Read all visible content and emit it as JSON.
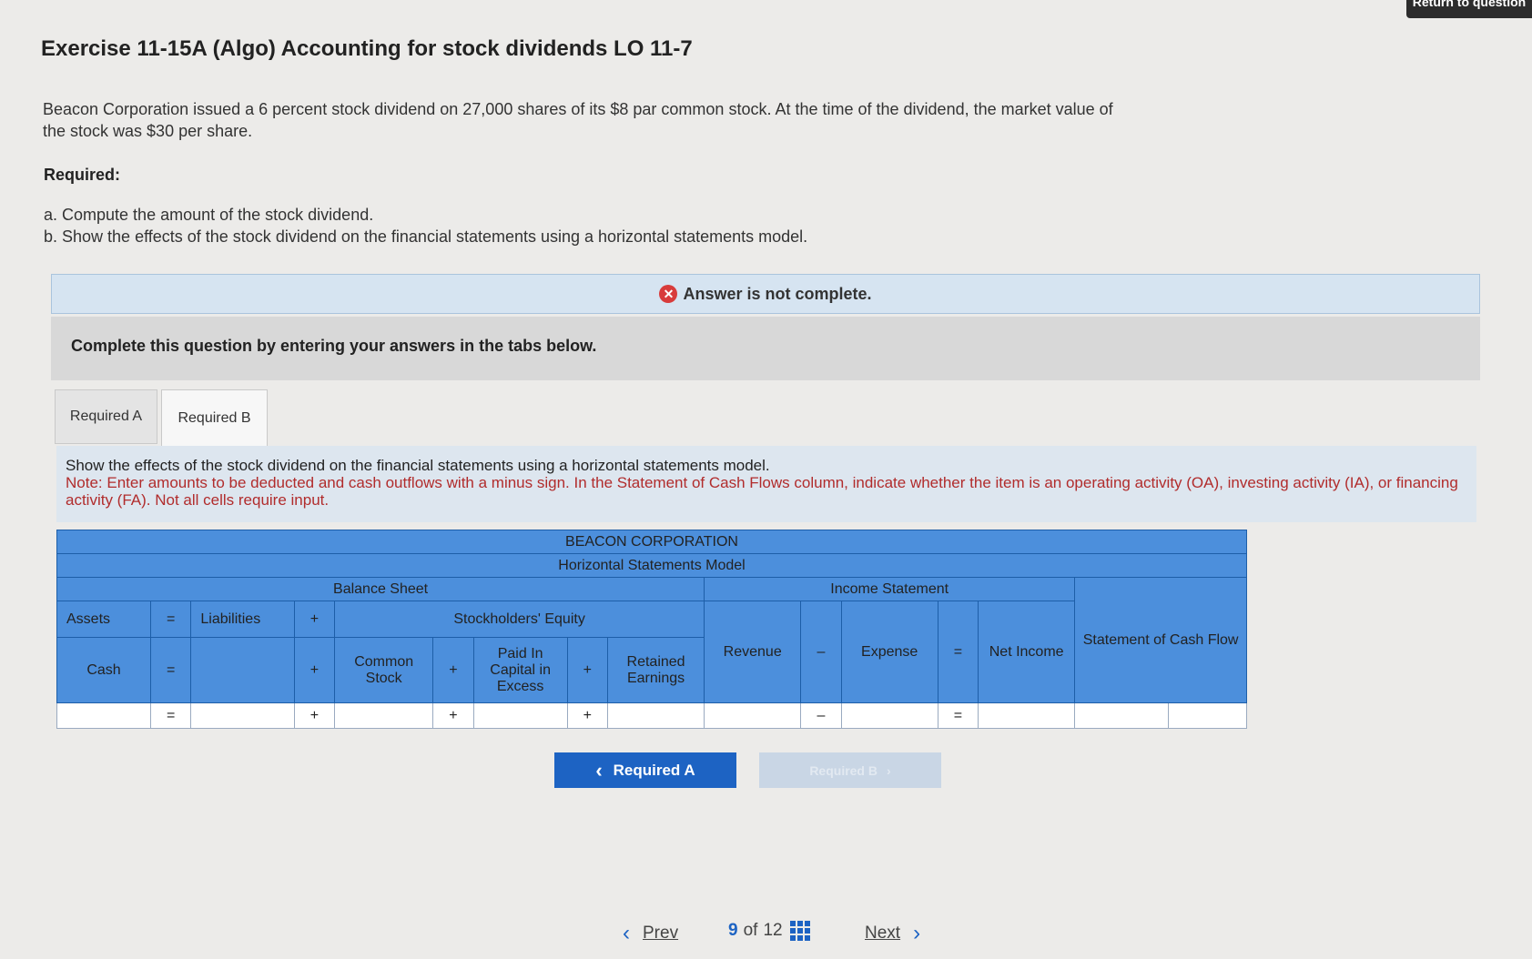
{
  "header": {
    "return_label": "Return to question"
  },
  "title": "Exercise 11-15A (Algo) Accounting for stock dividends LO 11-7",
  "intro": "Beacon Corporation issued a 6 percent stock dividend on 27,000 shares of its $8 par common stock. At the time of the dividend, the market value of the stock was $30 per share.",
  "required_label": "Required:",
  "requirements": [
    "a. Compute the amount of the stock dividend.",
    "b. Show the effects of the stock dividend on the financial statements using a horizontal statements model."
  ],
  "status": {
    "icon": "x-circle-icon",
    "text": "Answer is not complete."
  },
  "instruction": "Complete this question by entering your answers in the tabs below.",
  "tabs": [
    {
      "label": "Required A"
    },
    {
      "label": "Required B",
      "active": true
    }
  ],
  "panel": {
    "prompt": "Show the effects of the stock dividend on the financial statements using a horizontal statements model.",
    "note": "Note: Enter amounts to be deducted and cash outflows with a minus sign. In the Statement of Cash Flows column, indicate whether the item is an operating activity (OA), investing activity (IA), or financing activity (FA). Not all cells require input."
  },
  "table": {
    "company": "BEACON CORPORATION",
    "model": "Horizontal Statements Model",
    "balance_sheet": "Balance Sheet",
    "income_statement": "Income Statement",
    "cash_flow": "Statement of Cash Flow",
    "assets": "Assets",
    "liabilities": "Liabilities",
    "equity": "Stockholders' Equity",
    "cash": "Cash",
    "common_stock": "Common Stock",
    "paid_in": "Paid In Capital in Excess",
    "retained": "Retained Earnings",
    "revenue": "Revenue",
    "expense": "Expense",
    "net_income": "Net Income",
    "eq": "=",
    "plus": "+",
    "minus": "–"
  },
  "nav": {
    "prev_req": "Required A",
    "next_req": "Required B",
    "prev": "Prev",
    "page_current": "9",
    "page_of": "of",
    "page_total": "12",
    "next": "Next"
  },
  "colors": {
    "accent": "#1d63c3",
    "header_blue": "#4c8fdc",
    "error": "#d83b3b",
    "note_red": "#b12c2c"
  }
}
